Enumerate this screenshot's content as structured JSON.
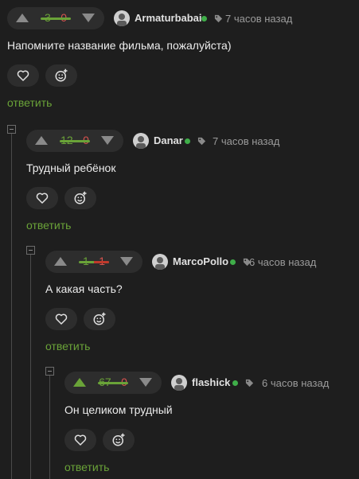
{
  "colors": {
    "background": "#1e1e1e",
    "accent_green": "#6aa338",
    "minus_red": "#d9534f",
    "online": "#3fae49"
  },
  "comments": [
    {
      "score_plus": "3",
      "score_sep": "-",
      "score_minus": "0",
      "plus_fraction": 1.0,
      "username": "Armaturbabai",
      "time": "7 часов назад",
      "text": "Напомните название фильма, пожалуйста)",
      "reply": "ответить",
      "avatar_icon": "avatar-icon"
    },
    {
      "score_plus": "12",
      "score_sep": "-",
      "score_minus": "0",
      "plus_fraction": 1.0,
      "username": "Danar",
      "time": "7 часов назад",
      "text": "Трудный ребёнок",
      "reply": "ответить",
      "avatar_icon": "avatar-icon"
    },
    {
      "score_plus": "1",
      "score_sep": "-",
      "score_minus": "1",
      "plus_fraction": 0.5,
      "username": "MarcoPollo",
      "time": "6 часов назад",
      "text": "А какая часть?",
      "reply": "ответить",
      "avatar_icon": "avatar-icon"
    },
    {
      "score_plus": "67",
      "score_sep": "-",
      "score_minus": "0",
      "plus_fraction": 1.0,
      "upvoted": true,
      "username": "flashick",
      "time": "6 часов назад",
      "text": "Он целиком трудный",
      "reply": "ответить",
      "avatar_icon": "avatar-icon"
    }
  ]
}
